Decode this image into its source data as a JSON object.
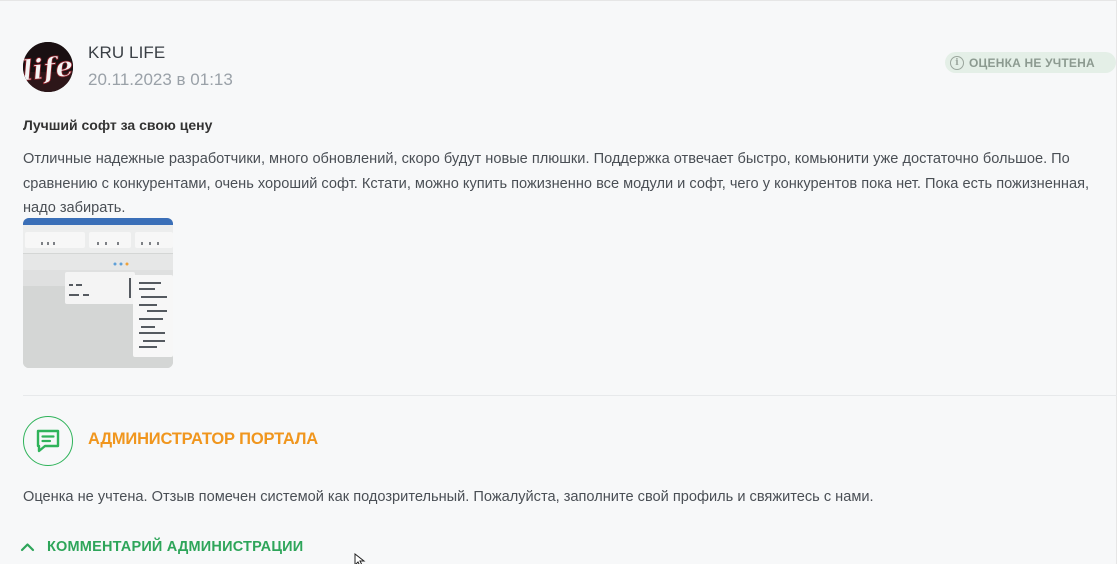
{
  "review": {
    "author": "KRU LIFE",
    "date": "20.11.2023 в 01:13",
    "avatar_text": "life",
    "badge": "ОЦЕНКА НЕ УЧТЕНА",
    "badge_icon": "info-icon",
    "title": "Лучший софт за свою цену",
    "text": "Отличные надежные разработчики, много обновлений, скоро будут новые плюшки. Поддержка отвечает быстро, комьюнити уже достаточно большое. По сравнению с конкурентами, очень хороший софт. Кстати, можно купить пожизненно все модули и софт, чего у конкурентов пока нет. Пока есть пожизненная, надо забирать.",
    "attachment_icon": "screenshot-thumbnail"
  },
  "admin": {
    "name": "АДМИНИСТРАТОР ПОРТАЛА",
    "avatar_icon": "chat-message-icon",
    "text": "Оценка не учтена. Отзыв помечен системой как подозрительный. Пожалуйста, заполните свой профиль и свяжитесь с нами.",
    "comment_toggle": "КОММЕНТАРИЙ АДМИНИСТРАЦИИ",
    "toggle_icon": "chevron-up-icon"
  },
  "colors": {
    "accent_green": "#2ea55a",
    "admin_orange": "#f0961e",
    "badge_bg": "#e4efe7",
    "date_gray": "#9aa1a8"
  }
}
